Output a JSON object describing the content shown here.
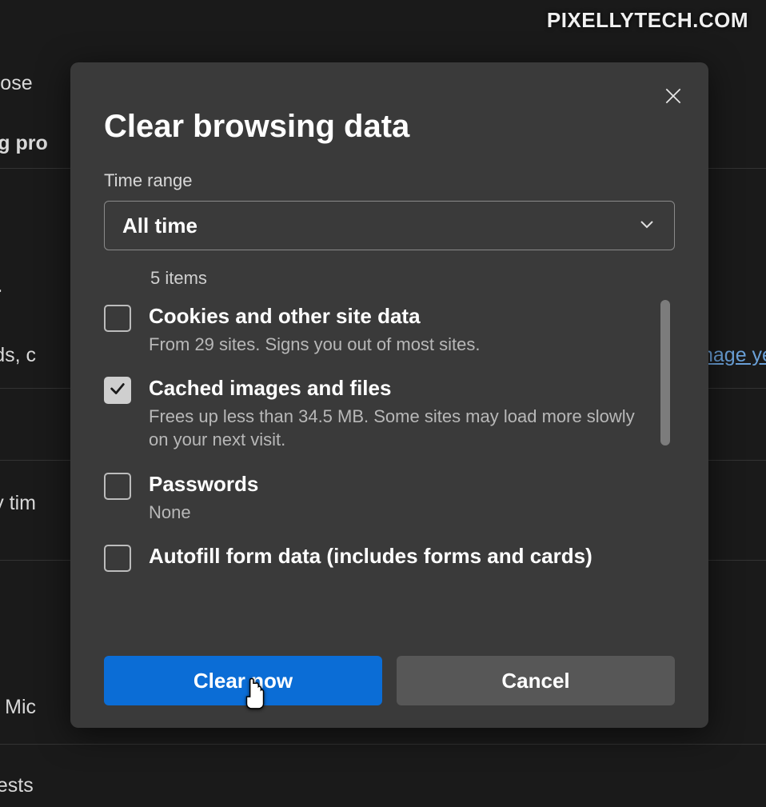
{
  "watermark": "PIXELLYTECH.COM",
  "background": {
    "t1": "choose",
    "t2": "ng pro",
    "t3": "a",
    "t4": "ords, c",
    "link": "nage ye",
    "t5": "",
    "t6": "ery tim",
    "t7": "for Mic",
    "t8": "uests"
  },
  "dialog": {
    "title": "Clear browsing data",
    "timeRangeLabel": "Time range",
    "timeRangeValue": "All time",
    "countLabel": "5 items",
    "options": [
      {
        "title": "Cookies and other site data",
        "desc": "From 29 sites. Signs you out of most sites.",
        "checked": false
      },
      {
        "title": "Cached images and files",
        "desc": "Frees up less than 34.5 MB. Some sites may load more slowly on your next visit.",
        "checked": true
      },
      {
        "title": "Passwords",
        "desc": "None",
        "checked": false
      },
      {
        "title": "Autofill form data (includes forms and cards)",
        "desc": "",
        "checked": false
      }
    ],
    "primaryLabel": "Clear now",
    "secondaryLabel": "Cancel"
  }
}
